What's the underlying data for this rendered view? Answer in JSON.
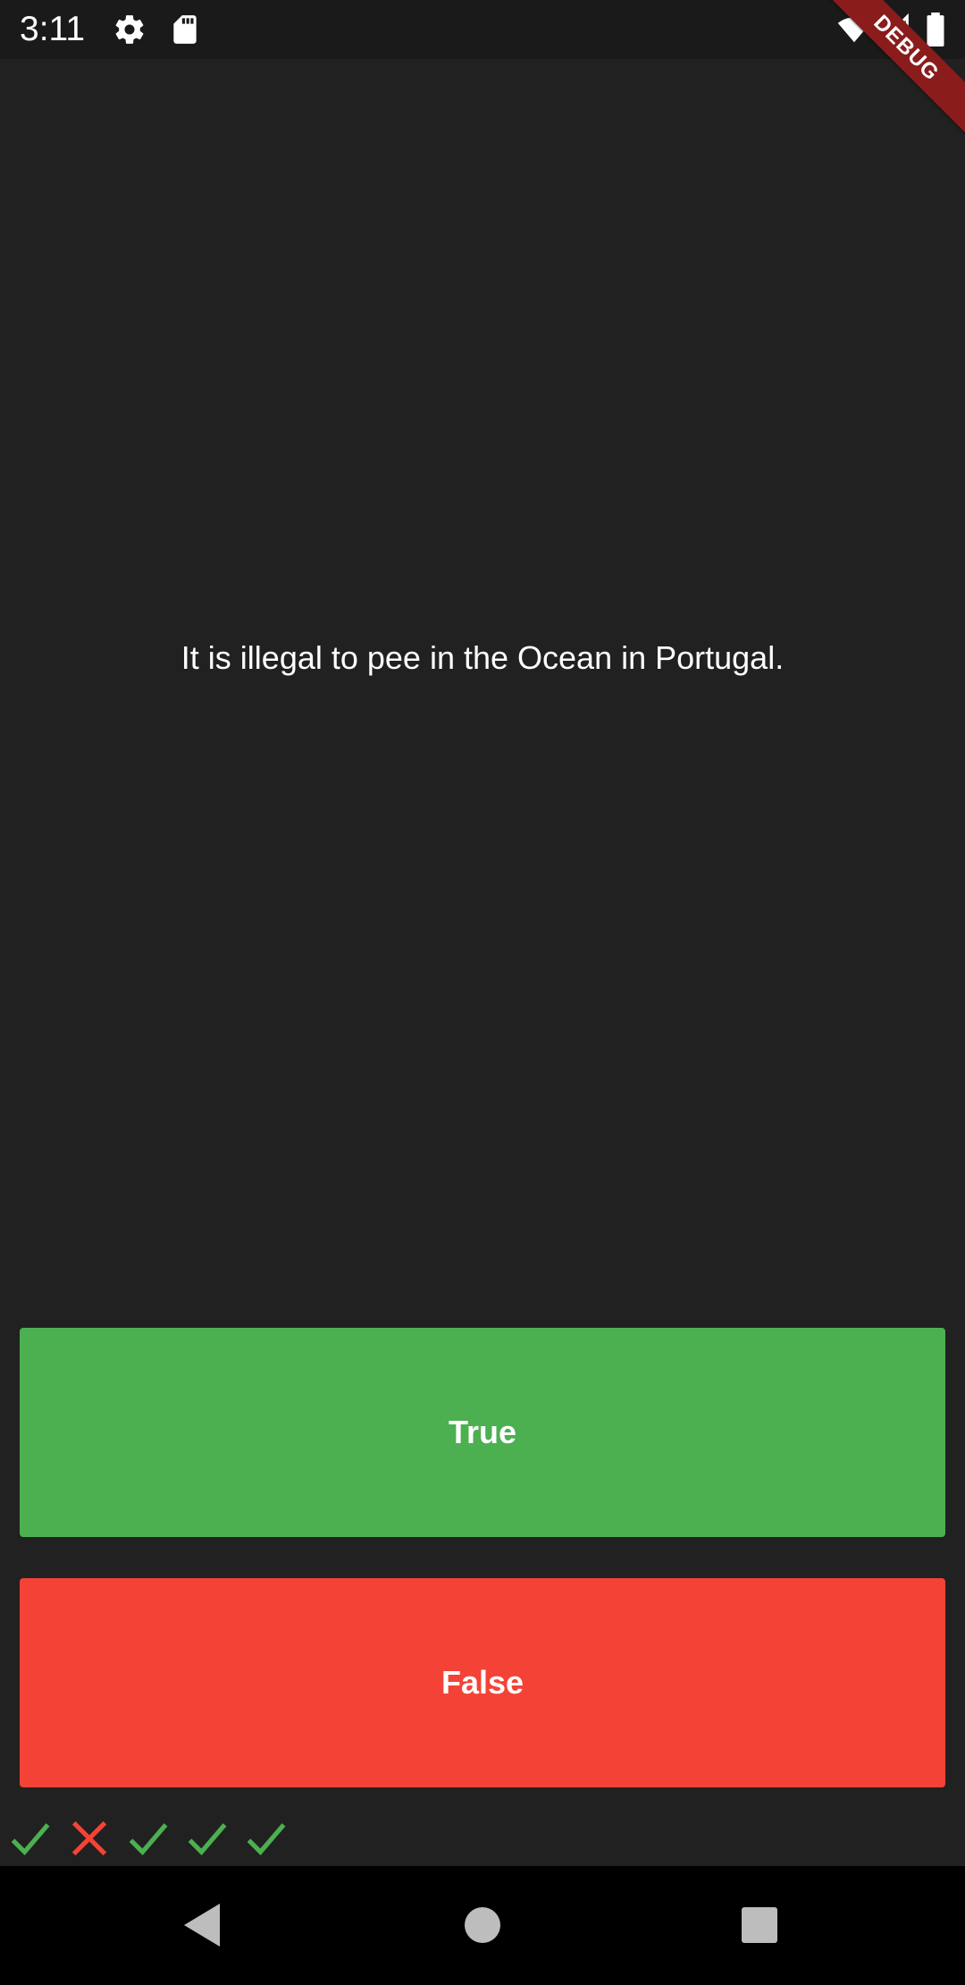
{
  "status_bar": {
    "time": "3:11",
    "icons": [
      "settings-icon",
      "sd-card-icon",
      "wifi-icon",
      "cell-signal-icon",
      "battery-icon"
    ]
  },
  "debug_banner": "DEBUG",
  "quiz": {
    "question": "It is illegal to pee in the Ocean in Portugal.",
    "true_label": "True",
    "false_label": "False",
    "true_color": "#4caf50",
    "false_color": "#f44336",
    "background": "#212121"
  },
  "score": [
    "check-icon",
    "close-icon",
    "check-icon",
    "check-icon",
    "check-icon"
  ],
  "nav_bar": {
    "buttons": [
      "back-icon",
      "home-icon",
      "recents-icon"
    ]
  }
}
